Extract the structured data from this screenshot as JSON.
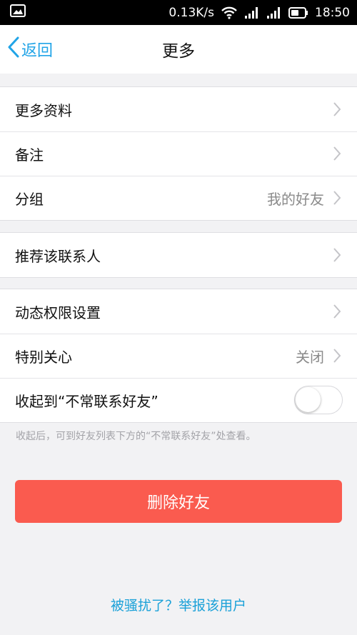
{
  "status_bar": {
    "network_speed": "0.13K/s",
    "time": "18:50",
    "icons": [
      "image-icon",
      "wifi-icon",
      "signal-icon",
      "signal-icon",
      "battery-icon"
    ]
  },
  "nav": {
    "back_label": "返回",
    "title": "更多",
    "accent_color": "#21a4e7"
  },
  "group1": {
    "items": [
      {
        "label": "更多资料",
        "value": ""
      },
      {
        "label": "备注",
        "value": ""
      },
      {
        "label": "分组",
        "value": "我的好友"
      }
    ]
  },
  "group2": {
    "items": [
      {
        "label": "推荐该联系人",
        "value": ""
      }
    ]
  },
  "group3": {
    "items": [
      {
        "label": "动态权限设置",
        "value": ""
      },
      {
        "label": "特别关心",
        "value": "关闭"
      },
      {
        "label": "收起到“不常联系好友”",
        "toggle_on": false
      }
    ]
  },
  "hint_text": "收起后，可到好友列表下方的“不常联系好友”处查看。",
  "delete_button": {
    "label": "删除好友",
    "color": "#fa5b4f"
  },
  "report_link": "被骚扰了？举报该用户"
}
